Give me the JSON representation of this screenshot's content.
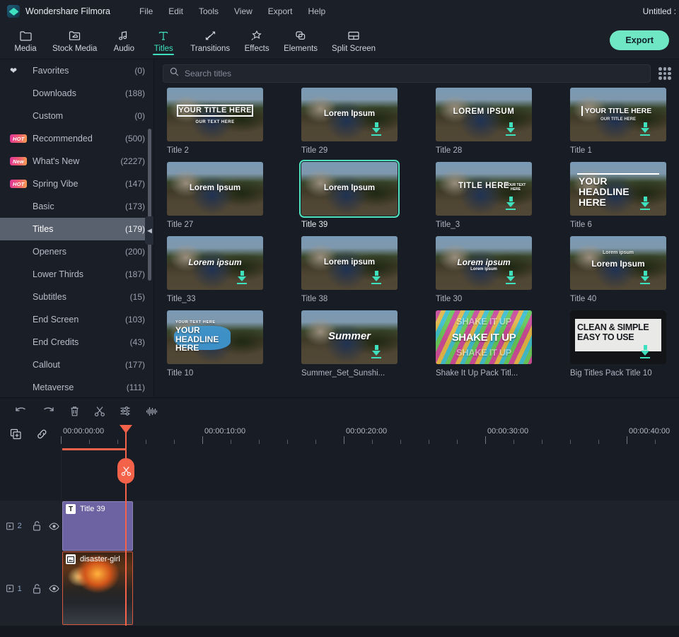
{
  "titlebar": {
    "app_name": "Wondershare Filmora",
    "logo_icon": "filmora-diamond-logo",
    "menus": [
      "File",
      "Edit",
      "Tools",
      "View",
      "Export",
      "Help"
    ],
    "document_title": "Untitled :"
  },
  "ribbon": {
    "tabs": [
      {
        "label": "Media",
        "icon": "folder-icon",
        "active": false
      },
      {
        "label": "Stock Media",
        "icon": "cloud-folder-icon",
        "active": false
      },
      {
        "label": "Audio",
        "icon": "music-note-icon",
        "active": false
      },
      {
        "label": "Titles",
        "icon": "text-T-icon",
        "active": true
      },
      {
        "label": "Transitions",
        "icon": "transition-arrows-icon",
        "active": false
      },
      {
        "label": "Effects",
        "icon": "sparkle-star-icon",
        "active": false
      },
      {
        "label": "Elements",
        "icon": "layers-copy-icon",
        "active": false
      },
      {
        "label": "Split Screen",
        "icon": "split-screen-icon",
        "active": false
      }
    ],
    "export_label": "Export",
    "accent_color": "#6fe6c4"
  },
  "sidebar": {
    "items": [
      {
        "label": "Favorites",
        "count": "(0)",
        "badge": "",
        "icon": "heart-icon",
        "active": false
      },
      {
        "label": "Downloads",
        "count": "(188)",
        "badge": "",
        "icon": "",
        "active": false
      },
      {
        "label": "Custom",
        "count": "(0)",
        "badge": "",
        "icon": "",
        "active": false
      },
      {
        "label": "Recommended",
        "count": "(500)",
        "badge": "HOT",
        "icon": "",
        "active": false
      },
      {
        "label": "What's New",
        "count": "(2227)",
        "badge": "New",
        "icon": "",
        "active": false
      },
      {
        "label": "Spring Vibe",
        "count": "(147)",
        "badge": "HOT",
        "icon": "",
        "active": false
      },
      {
        "label": "Basic",
        "count": "(173)",
        "badge": "",
        "icon": "",
        "active": false
      },
      {
        "label": "Titles",
        "count": "(179)",
        "badge": "",
        "icon": "",
        "active": true
      },
      {
        "label": "Openers",
        "count": "(200)",
        "badge": "",
        "icon": "",
        "active": false
      },
      {
        "label": "Lower Thirds",
        "count": "(187)",
        "badge": "",
        "icon": "",
        "active": false
      },
      {
        "label": "Subtitles",
        "count": "(15)",
        "badge": "",
        "icon": "",
        "active": false
      },
      {
        "label": "End Screen",
        "count": "(103)",
        "badge": "",
        "icon": "",
        "active": false
      },
      {
        "label": "End Credits",
        "count": "(43)",
        "badge": "",
        "icon": "",
        "active": false
      },
      {
        "label": "Callout",
        "count": "(177)",
        "badge": "",
        "icon": "",
        "active": false
      },
      {
        "label": "Metaverse",
        "count": "(111)",
        "badge": "",
        "icon": "",
        "active": false
      }
    ],
    "collapse_icon": "collapse-left-arrow-icon",
    "badge_gradient": "#e0359b-#f8a250"
  },
  "library": {
    "search": {
      "placeholder": "Search titles",
      "value": "",
      "icon": "search-icon"
    },
    "view_toggle_icon": "grid-view-icon",
    "selection_color": "#4fe3c0",
    "items": [
      {
        "label": "Title 2",
        "preview_text": "YOUR TITLE HERE",
        "preview_sub": "OUR TEXT HERE",
        "style": "boxed",
        "selected": false,
        "downloadable": false
      },
      {
        "label": "Title 29",
        "preview_text": "Lorem Ipsum",
        "preview_sub": "",
        "style": "plain",
        "selected": false,
        "downloadable": true
      },
      {
        "label": "Title 28",
        "preview_text": "LOREM IPSUM",
        "preview_sub": "",
        "style": "caps",
        "selected": false,
        "downloadable": true
      },
      {
        "label": "Title 1",
        "preview_text": "YOUR TITLE HERE",
        "preview_sub": "OUR TITLE HERE",
        "style": "barleft",
        "selected": false,
        "downloadable": true
      },
      {
        "label": "Title 27",
        "preview_text": "Lorem Ipsum",
        "preview_sub": "",
        "style": "plain",
        "selected": false,
        "downloadable": false
      },
      {
        "label": "Title 39",
        "preview_text": "Lorem Ipsum",
        "preview_sub": "",
        "style": "plain",
        "selected": true,
        "downloadable": false
      },
      {
        "label": "Title_3",
        "preview_text": "TITLE HERE",
        "preview_sub": "YOUR TEXT HERE",
        "style": "caps",
        "selected": false,
        "downloadable": true
      },
      {
        "label": "Title 6",
        "preview_text": "YOUR HEADLINE HERE",
        "preview_sub": "",
        "style": "headline",
        "selected": false,
        "downloadable": true
      },
      {
        "label": "Title_33",
        "preview_text": "Lorem ipsum",
        "preview_sub": "",
        "style": "italic",
        "selected": false,
        "downloadable": true
      },
      {
        "label": "Title 38",
        "preview_text": "Lorem ipsum",
        "preview_sub": "",
        "style": "plain",
        "selected": false,
        "downloadable": true
      },
      {
        "label": "Title 30",
        "preview_text": "Lorem ipsum",
        "preview_sub": "Lorem ipsum",
        "style": "italic",
        "selected": false,
        "downloadable": true
      },
      {
        "label": "Title 40",
        "preview_text": "Lorem Ipsum",
        "preview_sub": "Lorem ipsum",
        "style": "double",
        "selected": false,
        "downloadable": true
      },
      {
        "label": "Title 10",
        "preview_text": "YOUR HEADLINE HERE",
        "preview_sub": "YOUR TEXT HERE",
        "style": "brush",
        "selected": false,
        "downloadable": false
      },
      {
        "label": "Summer_Set_Sunshi...",
        "preview_text": "Summer",
        "preview_sub": "",
        "style": "script",
        "selected": false,
        "downloadable": true
      },
      {
        "label": "Shake It Up Pack Titl...",
        "preview_text": "SHAKE IT UP",
        "preview_sub": "",
        "style": "shake",
        "selected": false,
        "downloadable": false
      },
      {
        "label": "Big Titles Pack Title 10",
        "preview_text": "CLEAN & SIMPLE EASY TO USE",
        "preview_sub": "",
        "style": "bigtitle",
        "selected": false,
        "downloadable": true
      }
    ]
  },
  "timeline": {
    "toolbar_icons": [
      "undo-icon",
      "redo-icon",
      "delete-trash-icon",
      "split-scissors-icon",
      "settings-sliders-icon",
      "audio-waveform-icon"
    ],
    "ruler_icons": [
      "add-media-icon",
      "link-chain-icon"
    ],
    "ruler_labels": [
      "00:00:00:00",
      "00:00:10:00",
      "00:00:20:00",
      "00:00:30:00",
      "00:00:40:00"
    ],
    "playhead_position": "00:00:00:00",
    "playhead_color": "#f4624a",
    "playhead_icon": "scissors-split-icon",
    "tracks": [
      {
        "number": "2",
        "type": "title",
        "lock_icon": "unlock-icon",
        "eye_icon": "eye-visible-icon",
        "clip": {
          "name": "Title 39",
          "chip": "T",
          "color": "#6d63a3"
        }
      },
      {
        "number": "1",
        "type": "video",
        "lock_icon": "unlock-icon",
        "eye_icon": "eye-visible-icon",
        "clip": {
          "name": "disaster-girl",
          "chip": "img",
          "color": "#d4593f"
        }
      }
    ]
  }
}
